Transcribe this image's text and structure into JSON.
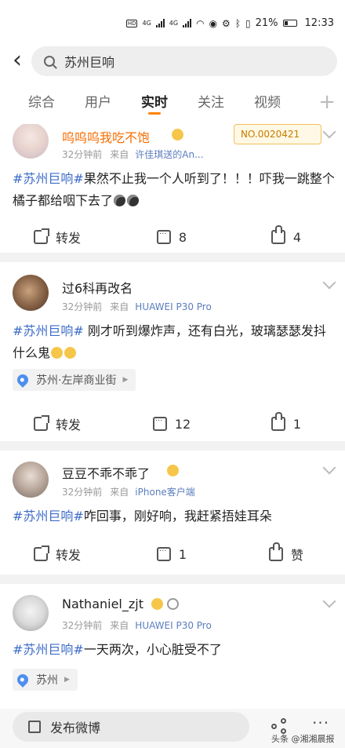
{
  "status_bar": {
    "battery": "21%",
    "time": "12:33",
    "signal1": "4G",
    "signal2": "4G"
  },
  "search": {
    "query": "苏州巨响"
  },
  "tabs": [
    {
      "label": "综合"
    },
    {
      "label": "用户"
    },
    {
      "label": "实时"
    },
    {
      "label": "关注"
    },
    {
      "label": "视频"
    }
  ],
  "active_tab": "实时",
  "posts": [
    {
      "user": "呜呜呜我吃不饱",
      "time": "32分钟前",
      "from_label": "来自",
      "source": "许佳琪送的An...",
      "badge": "NO.0020421",
      "tag": "#苏州巨响#",
      "text": "果然不止我一个人听到了！！！吓我一跳整个橘子都给咽下去了",
      "repost": "转发",
      "comments": "8",
      "likes": "4"
    },
    {
      "user": "过6科再改名",
      "time": "32分钟前",
      "from_label": "来自",
      "source": "HUAWEI P30 Pro",
      "tag": "#苏州巨响#",
      "text": " 刚才听到爆炸声，还有白光，玻璃瑟瑟发抖什么鬼",
      "location": "苏州·左岸商业街",
      "repost": "转发",
      "comments": "12",
      "likes": "1"
    },
    {
      "user": "豆豆不乖不乖了",
      "time": "32分钟前",
      "from_label": "来自",
      "source": "iPhone客户端",
      "tag": "#苏州巨响#",
      "text": "咋回事，刚好响，我赶紧捂娃耳朵",
      "repost": "转发",
      "comments": "1",
      "likes": "赞"
    },
    {
      "user": "Nathaniel_zjt",
      "time": "32分钟前",
      "from_label": "来自",
      "source": "HUAWEI P30 Pro",
      "tag": "#苏州巨响#",
      "text": "一天两次，小心脏受不了",
      "location": "苏州"
    }
  ],
  "bottom": {
    "compose_label": "发布微博",
    "watermark": "头条 @湘湘晨报"
  },
  "colors": {
    "accent": "#ff8200",
    "link": "#3d6cc8",
    "source": "#5b7dbd",
    "username_vip": "#f86c00"
  }
}
